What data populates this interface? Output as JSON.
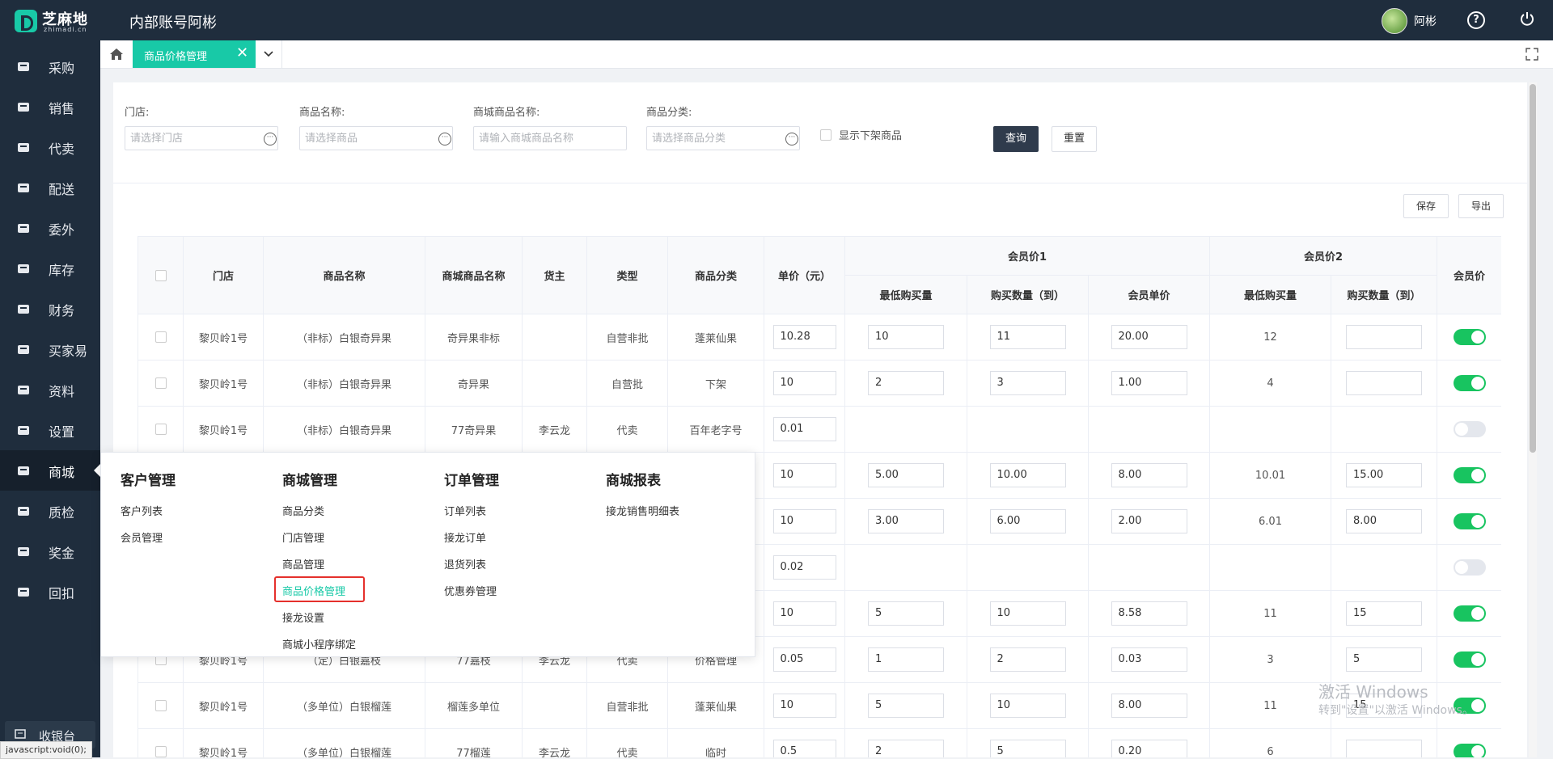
{
  "app": {
    "logo_text": "芝麻地",
    "logo_sub": "zhimadi.cn",
    "title": "内部账号阿彬",
    "user_name": "阿彬"
  },
  "sidebar": {
    "items": [
      {
        "label": "采购",
        "icon": "basket-icon"
      },
      {
        "label": "销售",
        "icon": "cart-icon"
      },
      {
        "label": "代卖",
        "icon": "tag-icon"
      },
      {
        "label": "配送",
        "icon": "truck-icon"
      },
      {
        "label": "委外",
        "icon": "outsource-icon"
      },
      {
        "label": "库存",
        "icon": "warehouse-icon"
      },
      {
        "label": "财务",
        "icon": "yen-icon"
      },
      {
        "label": "买家易",
        "icon": "shop-icon"
      },
      {
        "label": "资料",
        "icon": "database-icon"
      },
      {
        "label": "设置",
        "icon": "gear-icon"
      },
      {
        "label": "商城",
        "icon": "mall-icon",
        "active": true
      },
      {
        "label": "质检",
        "icon": "inspect-icon"
      },
      {
        "label": "奖金",
        "icon": "bonus-icon"
      },
      {
        "label": "回扣",
        "icon": "rebate-icon"
      }
    ],
    "cashier_label": "收银台"
  },
  "status_bar": "javascript:void(0);",
  "tabs": {
    "active_label": "商品价格管理",
    "close_glyph": "✕"
  },
  "filters": {
    "store_label": "门店:",
    "store_placeholder": "请选择门店",
    "product_label": "商品名称:",
    "product_placeholder": "请选择商品",
    "mall_product_label": "商城商品名称:",
    "mall_product_placeholder": "请输入商城商品名称",
    "category_label": "商品分类:",
    "category_placeholder": "请选择商品分类",
    "show_offshelf_label": "显示下架商品",
    "query_label": "查询",
    "reset_label": "重置",
    "more_glyph": "···"
  },
  "actions": {
    "save_label": "保存",
    "export_label": "导出"
  },
  "table": {
    "headers": {
      "store": "门店",
      "product": "商品名称",
      "mall_product": "商城商品名称",
      "owner": "货主",
      "type": "类型",
      "category": "商品分类",
      "unit_price": "单价（元）",
      "member1": "会员价1",
      "member2": "会员价2",
      "member_price": "会员价",
      "min_qty": "最低购买量",
      "qty_to": "购买数量（到）",
      "member_unit": "会员单价"
    },
    "rows": [
      {
        "store": "黎贝岭1号",
        "product": "（非标）白银奇异果",
        "mall": "奇异果非标",
        "owner": "",
        "type": "自营非批",
        "category": "蓬莱仙果",
        "price": "10.28",
        "m1_min": "10",
        "m1_to": "11",
        "m1_unit": "20.00",
        "m2_min": "12",
        "m2_to": "",
        "on": true
      },
      {
        "store": "黎贝岭1号",
        "product": "（非标）白银奇异果",
        "mall": "奇异果",
        "owner": "",
        "type": "自营批",
        "category": "下架",
        "price": "10",
        "m1_min": "2",
        "m1_to": "3",
        "m1_unit": "1.00",
        "m2_min": "4",
        "m2_to": "",
        "on": true
      },
      {
        "store": "黎贝岭1号",
        "product": "（非标）白银奇异果",
        "mall": "77奇异果",
        "owner": "李云龙",
        "type": "代卖",
        "category": "百年老字号",
        "price": "0.01",
        "m1_min": "",
        "m1_to": "",
        "m1_unit": "",
        "m2_min": "",
        "m2_to": "",
        "on": false
      },
      {
        "store": "",
        "product": "",
        "mall": "",
        "owner": "",
        "type": "",
        "category": "",
        "price": "10",
        "m1_min": "5.00",
        "m1_to": "10.00",
        "m1_unit": "8.00",
        "m2_min": "10.01",
        "m2_to": "15.00",
        "on": true
      },
      {
        "store": "",
        "product": "",
        "mall": "",
        "owner": "",
        "type": "",
        "category": "",
        "price": "10",
        "m1_min": "3.00",
        "m1_to": "6.00",
        "m1_unit": "2.00",
        "m2_min": "6.01",
        "m2_to": "8.00",
        "on": true
      },
      {
        "store": "",
        "product": "",
        "mall": "",
        "owner": "",
        "type": "",
        "category": "",
        "price": "0.02",
        "m1_min": "",
        "m1_to": "",
        "m1_unit": "",
        "m2_min": "",
        "m2_to": "",
        "on": false
      },
      {
        "store": "",
        "product": "",
        "mall": "",
        "owner": "",
        "type": "",
        "category": "",
        "price": "10",
        "m1_min": "5",
        "m1_to": "10",
        "m1_unit": "8.58",
        "m2_min": "11",
        "m2_to": "15",
        "on": true
      },
      {
        "store": "黎贝岭1号",
        "product": "（定）白银嘉枝",
        "mall": "77嘉枝",
        "owner": "李云龙",
        "type": "代卖",
        "category": "价格管理",
        "price": "0.05",
        "m1_min": "1",
        "m1_to": "2",
        "m1_unit": "0.03",
        "m2_min": "3",
        "m2_to": "5",
        "on": true
      },
      {
        "store": "黎贝岭1号",
        "product": "（多单位）白银榴莲",
        "mall": "榴莲多单位",
        "owner": "",
        "type": "自营非批",
        "category": "蓬莱仙果",
        "price": "10",
        "m1_min": "5",
        "m1_to": "10",
        "m1_unit": "8.00",
        "m2_min": "11",
        "m2_to": "15",
        "on": true
      },
      {
        "store": "黎贝岭1号",
        "product": "（多单位）白银榴莲",
        "mall": "77榴莲",
        "owner": "李云龙",
        "type": "代卖",
        "category": "临时",
        "price": "0.5",
        "m1_min": "2",
        "m1_to": "5",
        "m1_unit": "0.20",
        "m2_min": "6",
        "m2_to": "",
        "on": true
      }
    ]
  },
  "mega_menu": {
    "columns": [
      {
        "title": "客户管理",
        "items": [
          "客户列表",
          "会员管理"
        ]
      },
      {
        "title": "商城管理",
        "items": [
          "商品分类",
          "门店管理",
          "商品管理",
          "商品价格管理",
          "接龙设置",
          "商城小程序绑定"
        ]
      },
      {
        "title": "订单管理",
        "items": [
          "订单列表",
          "接龙订单",
          "退货列表",
          "优惠券管理"
        ]
      },
      {
        "title": "商城报表",
        "items": [
          "接龙销售明细表"
        ]
      }
    ],
    "selected": "商品价格管理"
  },
  "watermark": {
    "line1": "激活 Windows",
    "line2": "转到\"设置\"以激活 Windows。"
  },
  "colors": {
    "accent": "#18c9a7",
    "sidebar_bg": "#1f2d3d",
    "toggle_on": "#18c460",
    "highlight_border": "#e5302c"
  }
}
